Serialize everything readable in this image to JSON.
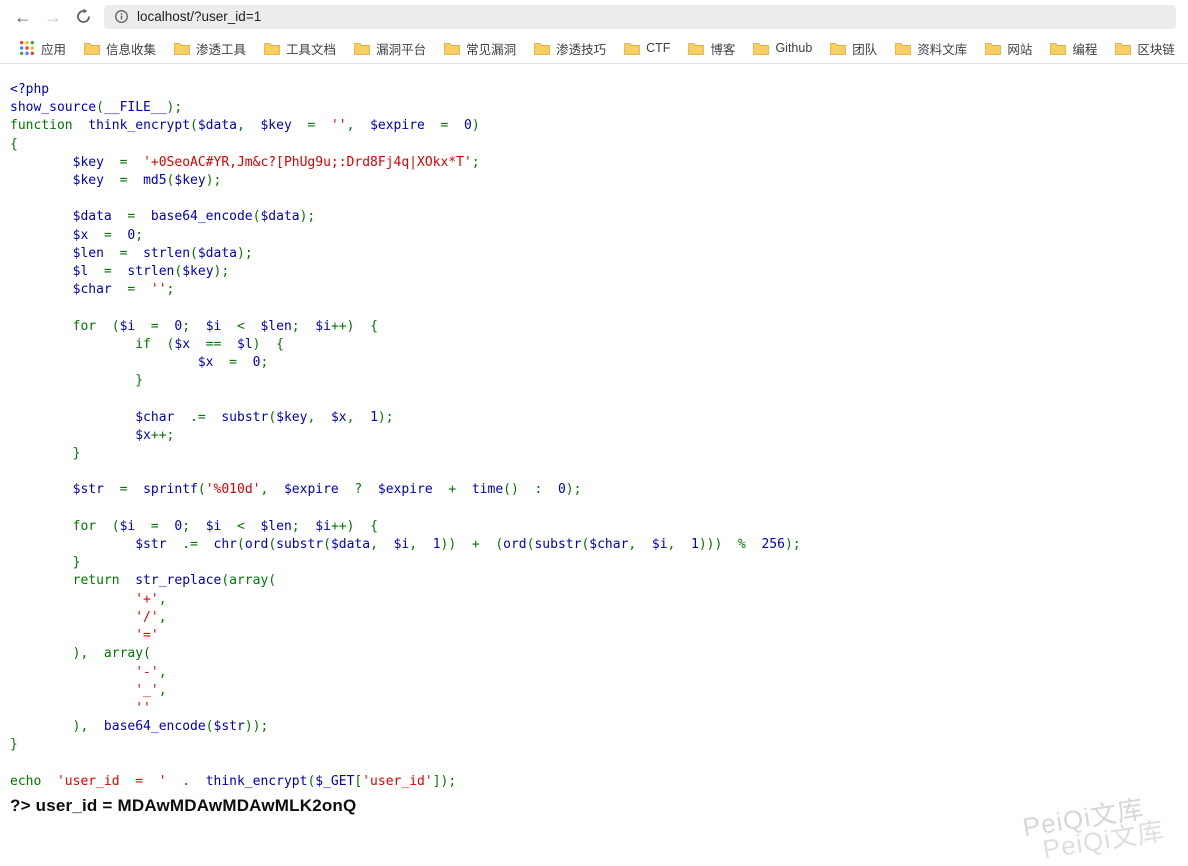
{
  "browser": {
    "url": "localhost/?user_id=1",
    "icons": {
      "back": "←",
      "forward": "→"
    }
  },
  "bookmarks": {
    "apps": "应用",
    "folders": [
      "信息收集",
      "渗透工具",
      "工具文档",
      "漏洞平台",
      "常见漏洞",
      "渗透技巧",
      "CTF",
      "博客",
      "Github",
      "团队",
      "资料文库",
      "网站",
      "编程",
      "区块链"
    ]
  },
  "colors": {
    "folder": "#FBCF5F",
    "folder_border": "#DFA943",
    "php_keyword": "#007700",
    "php_default": "#0000BB",
    "php_string": "#DD0000"
  },
  "code": {
    "colors": {
      "k": "#007700",
      "d": "#0000BB",
      "s": "#DD0000"
    },
    "lines": [
      [
        [
          "<?php",
          "d"
        ]
      ],
      [
        [
          "show_source",
          "d"
        ],
        [
          "(",
          "k"
        ],
        [
          "__FILE__",
          "d"
        ],
        [
          ");",
          "k"
        ]
      ],
      [
        [
          "function  ",
          "k"
        ],
        [
          "think_encrypt",
          "d"
        ],
        [
          "(",
          "k"
        ],
        [
          "$data",
          "d"
        ],
        [
          ",  ",
          "k"
        ],
        [
          "$key",
          "d"
        ],
        [
          "  =  ",
          "k"
        ],
        [
          "''",
          "s"
        ],
        [
          ",  ",
          "k"
        ],
        [
          "$expire",
          "d"
        ],
        [
          "  =  ",
          "k"
        ],
        [
          "0",
          "d"
        ],
        [
          ")",
          "k"
        ]
      ],
      [
        [
          "{",
          "k"
        ]
      ],
      [
        [
          "        $key",
          "d"
        ],
        [
          "  =  ",
          "k"
        ],
        [
          "'+0SeoAC#YR,Jm&c?[PhUg9u;:Drd8Fj4q|XOkx*T'",
          "s"
        ],
        [
          ";",
          "k"
        ]
      ],
      [
        [
          "        $key",
          "d"
        ],
        [
          "  =  ",
          "k"
        ],
        [
          "md5",
          "d"
        ],
        [
          "(",
          "k"
        ],
        [
          "$key",
          "d"
        ],
        [
          ");",
          "k"
        ]
      ],
      [],
      [
        [
          "        $data",
          "d"
        ],
        [
          "  =  ",
          "k"
        ],
        [
          "base64_encode",
          "d"
        ],
        [
          "(",
          "k"
        ],
        [
          "$data",
          "d"
        ],
        [
          ");",
          "k"
        ]
      ],
      [
        [
          "        $x",
          "d"
        ],
        [
          "  =  ",
          "k"
        ],
        [
          "0",
          "d"
        ],
        [
          ";",
          "k"
        ]
      ],
      [
        [
          "        $len",
          "d"
        ],
        [
          "  =  ",
          "k"
        ],
        [
          "strlen",
          "d"
        ],
        [
          "(",
          "k"
        ],
        [
          "$data",
          "d"
        ],
        [
          ");",
          "k"
        ]
      ],
      [
        [
          "        $l",
          "d"
        ],
        [
          "  =  ",
          "k"
        ],
        [
          "strlen",
          "d"
        ],
        [
          "(",
          "k"
        ],
        [
          "$key",
          "d"
        ],
        [
          ");",
          "k"
        ]
      ],
      [
        [
          "        $char",
          "d"
        ],
        [
          "  =  ",
          "k"
        ],
        [
          "''",
          "s"
        ],
        [
          ";",
          "k"
        ]
      ],
      [],
      [
        [
          "        for  (",
          "k"
        ],
        [
          "$i",
          "d"
        ],
        [
          "  =  ",
          "k"
        ],
        [
          "0",
          "d"
        ],
        [
          ";  ",
          "k"
        ],
        [
          "$i",
          "d"
        ],
        [
          "  <  ",
          "k"
        ],
        [
          "$len",
          "d"
        ],
        [
          ";  ",
          "k"
        ],
        [
          "$i",
          "d"
        ],
        [
          "++)  {",
          "k"
        ]
      ],
      [
        [
          "                if  (",
          "k"
        ],
        [
          "$x",
          "d"
        ],
        [
          "  ==  ",
          "k"
        ],
        [
          "$l",
          "d"
        ],
        [
          ")  {",
          "k"
        ]
      ],
      [
        [
          "                        $x",
          "d"
        ],
        [
          "  =  ",
          "k"
        ],
        [
          "0",
          "d"
        ],
        [
          ";",
          "k"
        ]
      ],
      [
        [
          "                }",
          "k"
        ]
      ],
      [],
      [
        [
          "                $char",
          "d"
        ],
        [
          "  .=  ",
          "k"
        ],
        [
          "substr",
          "d"
        ],
        [
          "(",
          "k"
        ],
        [
          "$key",
          "d"
        ],
        [
          ",  ",
          "k"
        ],
        [
          "$x",
          "d"
        ],
        [
          ",  ",
          "k"
        ],
        [
          "1",
          "d"
        ],
        [
          ");",
          "k"
        ]
      ],
      [
        [
          "                $x",
          "d"
        ],
        [
          "++;",
          "k"
        ]
      ],
      [
        [
          "        }",
          "k"
        ]
      ],
      [],
      [
        [
          "        $str",
          "d"
        ],
        [
          "  =  ",
          "k"
        ],
        [
          "sprintf",
          "d"
        ],
        [
          "(",
          "k"
        ],
        [
          "'%010d'",
          "s"
        ],
        [
          ",  ",
          "k"
        ],
        [
          "$expire",
          "d"
        ],
        [
          "  ?  ",
          "k"
        ],
        [
          "$expire",
          "d"
        ],
        [
          "  +  ",
          "k"
        ],
        [
          "time",
          "d"
        ],
        [
          "()  :  ",
          "k"
        ],
        [
          "0",
          "d"
        ],
        [
          ");",
          "k"
        ]
      ],
      [],
      [
        [
          "        for  (",
          "k"
        ],
        [
          "$i",
          "d"
        ],
        [
          "  =  ",
          "k"
        ],
        [
          "0",
          "d"
        ],
        [
          ";  ",
          "k"
        ],
        [
          "$i",
          "d"
        ],
        [
          "  <  ",
          "k"
        ],
        [
          "$len",
          "d"
        ],
        [
          ";  ",
          "k"
        ],
        [
          "$i",
          "d"
        ],
        [
          "++)  {",
          "k"
        ]
      ],
      [
        [
          "                $str",
          "d"
        ],
        [
          "  .=  ",
          "k"
        ],
        [
          "chr",
          "d"
        ],
        [
          "(",
          "k"
        ],
        [
          "ord",
          "d"
        ],
        [
          "(",
          "k"
        ],
        [
          "substr",
          "d"
        ],
        [
          "(",
          "k"
        ],
        [
          "$data",
          "d"
        ],
        [
          ",  ",
          "k"
        ],
        [
          "$i",
          "d"
        ],
        [
          ",  ",
          "k"
        ],
        [
          "1",
          "d"
        ],
        [
          "))  +  (",
          "k"
        ],
        [
          "ord",
          "d"
        ],
        [
          "(",
          "k"
        ],
        [
          "substr",
          "d"
        ],
        [
          "(",
          "k"
        ],
        [
          "$char",
          "d"
        ],
        [
          ",  ",
          "k"
        ],
        [
          "$i",
          "d"
        ],
        [
          ",  ",
          "k"
        ],
        [
          "1",
          "d"
        ],
        [
          ")))  %  ",
          "k"
        ],
        [
          "256",
          "d"
        ],
        [
          ");",
          "k"
        ]
      ],
      [
        [
          "        }",
          "k"
        ]
      ],
      [
        [
          "        return  ",
          "k"
        ],
        [
          "str_replace",
          "d"
        ],
        [
          "(array(",
          "k"
        ]
      ],
      [
        [
          "                ",
          "k"
        ],
        [
          "'+'",
          "s"
        ],
        [
          ",",
          "k"
        ]
      ],
      [
        [
          "                ",
          "k"
        ],
        [
          "'/'",
          "s"
        ],
        [
          ",",
          "k"
        ]
      ],
      [
        [
          "                ",
          "k"
        ],
        [
          "'='",
          "s"
        ]
      ],
      [
        [
          "        ),  array(",
          "k"
        ]
      ],
      [
        [
          "                ",
          "k"
        ],
        [
          "'-'",
          "s"
        ],
        [
          ",",
          "k"
        ]
      ],
      [
        [
          "                ",
          "k"
        ],
        [
          "'_'",
          "s"
        ],
        [
          ",",
          "k"
        ]
      ],
      [
        [
          "                ",
          "k"
        ],
        [
          "''",
          "s"
        ]
      ],
      [
        [
          "        ),  ",
          "k"
        ],
        [
          "base64_encode",
          "d"
        ],
        [
          "(",
          "k"
        ],
        [
          "$str",
          "d"
        ],
        [
          "));",
          "k"
        ]
      ],
      [
        [
          "}",
          "k"
        ]
      ],
      [],
      [
        [
          "echo  ",
          "k"
        ],
        [
          "'user_id  =  '",
          "s"
        ],
        [
          "  .  ",
          "k"
        ],
        [
          "think_encrypt",
          "d"
        ],
        [
          "(",
          "k"
        ],
        [
          "$_GET",
          "d"
        ],
        [
          "[",
          "k"
        ],
        [
          "'user_id'",
          "s"
        ],
        [
          "]);",
          "k"
        ]
      ]
    ]
  },
  "output_line": "?> user_id = MDAwMDAwMDAwMLK2onQ",
  "watermark": "PeiQi文库"
}
